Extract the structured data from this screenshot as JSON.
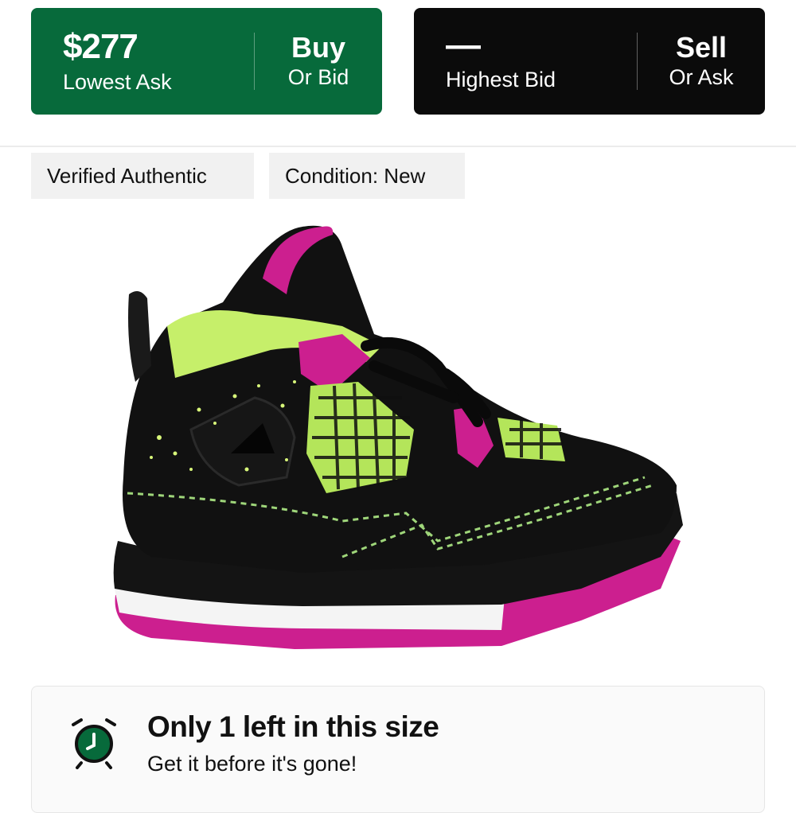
{
  "buy_panel": {
    "price": "$277",
    "price_label": "Lowest Ask",
    "action_top": "Buy",
    "action_bottom": "Or Bid",
    "color": "#076a3b"
  },
  "sell_panel": {
    "price": "—",
    "price_label": "Highest Bid",
    "action_top": "Sell",
    "action_bottom": "Or Ask",
    "color": "#0b0b0b"
  },
  "tags": {
    "authentic": "Verified Authentic",
    "condition": "Condition: New"
  },
  "product_image": {
    "icon": "sneaker-image",
    "colors": {
      "upper": "#111111",
      "accent": "#cc1f8f",
      "lining": "#c6ef6a"
    }
  },
  "stock_notice": {
    "icon": "alarm-clock-icon",
    "title": "Only 1 left in this size",
    "subtitle": "Get it before it's gone!"
  }
}
